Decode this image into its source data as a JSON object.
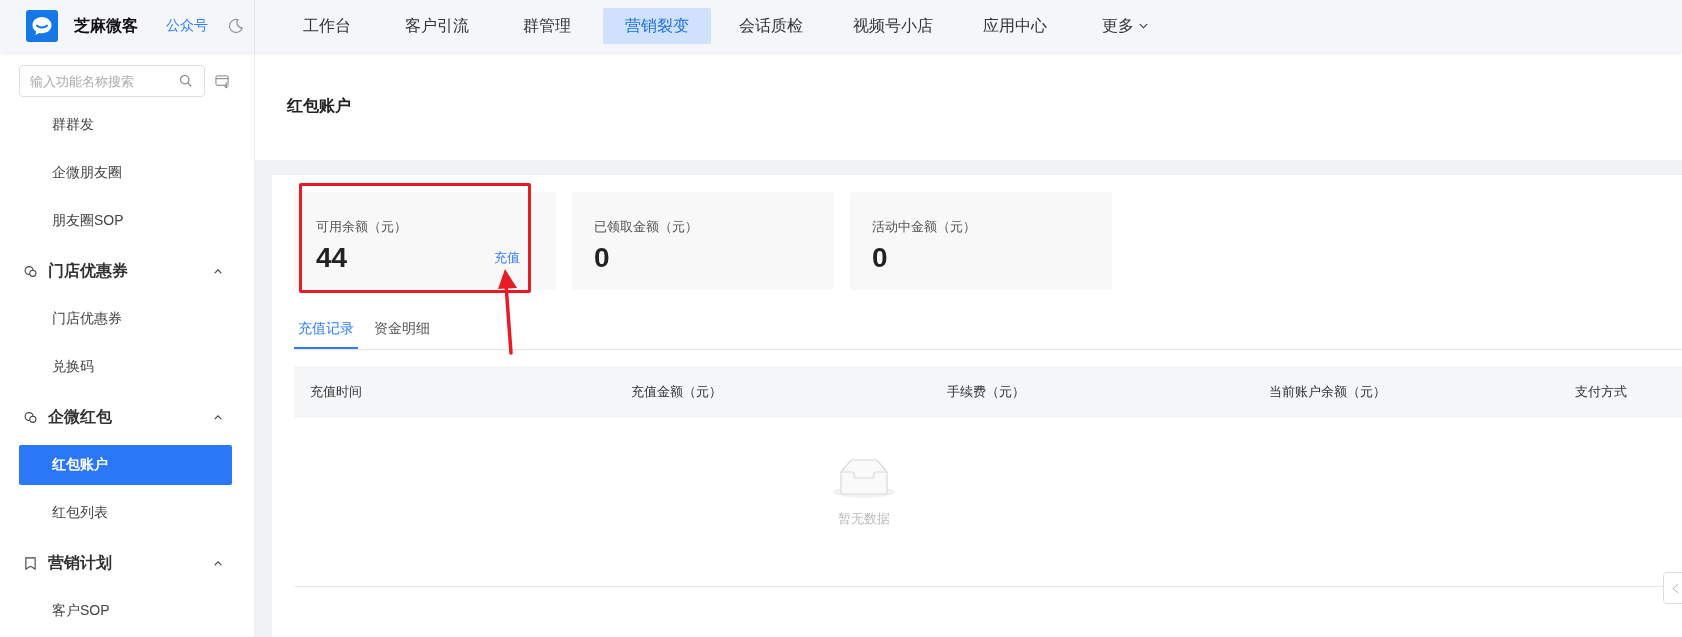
{
  "topbar": {
    "brand": "芝麻微客",
    "account_link": "公众号",
    "nav": [
      {
        "label": "工作台",
        "selected": false
      },
      {
        "label": "客户引流",
        "selected": false
      },
      {
        "label": "群管理",
        "selected": false
      },
      {
        "label": "营销裂变",
        "selected": true
      },
      {
        "label": "会话质检",
        "selected": false
      },
      {
        "label": "视频号小店",
        "selected": false
      },
      {
        "label": "应用中心",
        "selected": false
      },
      {
        "label": "更多",
        "selected": false,
        "dropdown": true
      }
    ]
  },
  "sidebar": {
    "search": {
      "placeholder": "输入功能名称搜索"
    },
    "items": [
      {
        "kind": "link",
        "label": "群群发",
        "selected": false
      },
      {
        "kind": "link",
        "label": "企微朋友圈",
        "selected": false
      },
      {
        "kind": "link",
        "label": "朋友圈SOP",
        "selected": false
      },
      {
        "kind": "group",
        "label": "门店优惠券",
        "expanded": true,
        "children": [
          {
            "label": "门店优惠券",
            "selected": false
          },
          {
            "label": "兑换码",
            "selected": false
          }
        ]
      },
      {
        "kind": "group",
        "label": "企微红包",
        "expanded": true,
        "children": [
          {
            "label": "红包账户",
            "selected": true
          },
          {
            "label": "红包列表",
            "selected": false
          }
        ]
      },
      {
        "kind": "group",
        "label": "营销计划",
        "expanded": true,
        "children": [
          {
            "label": "客户SOP",
            "selected": false
          }
        ]
      }
    ]
  },
  "page": {
    "title": "红包账户",
    "stats": [
      {
        "label": "可用余额（元）",
        "value": "44",
        "action": "充值"
      },
      {
        "label": "已领取金额（元）",
        "value": "0"
      },
      {
        "label": "活动中金额（元）",
        "value": "0"
      }
    ],
    "tabs": [
      {
        "label": "充值记录",
        "selected": true
      },
      {
        "label": "资金明细",
        "selected": false
      }
    ],
    "table": {
      "columns": [
        "充值时间",
        "充值金额（元）",
        "手续费（元）",
        "当前账户余额（元）",
        "支付方式"
      ],
      "empty_text": "暂无数据"
    }
  }
}
